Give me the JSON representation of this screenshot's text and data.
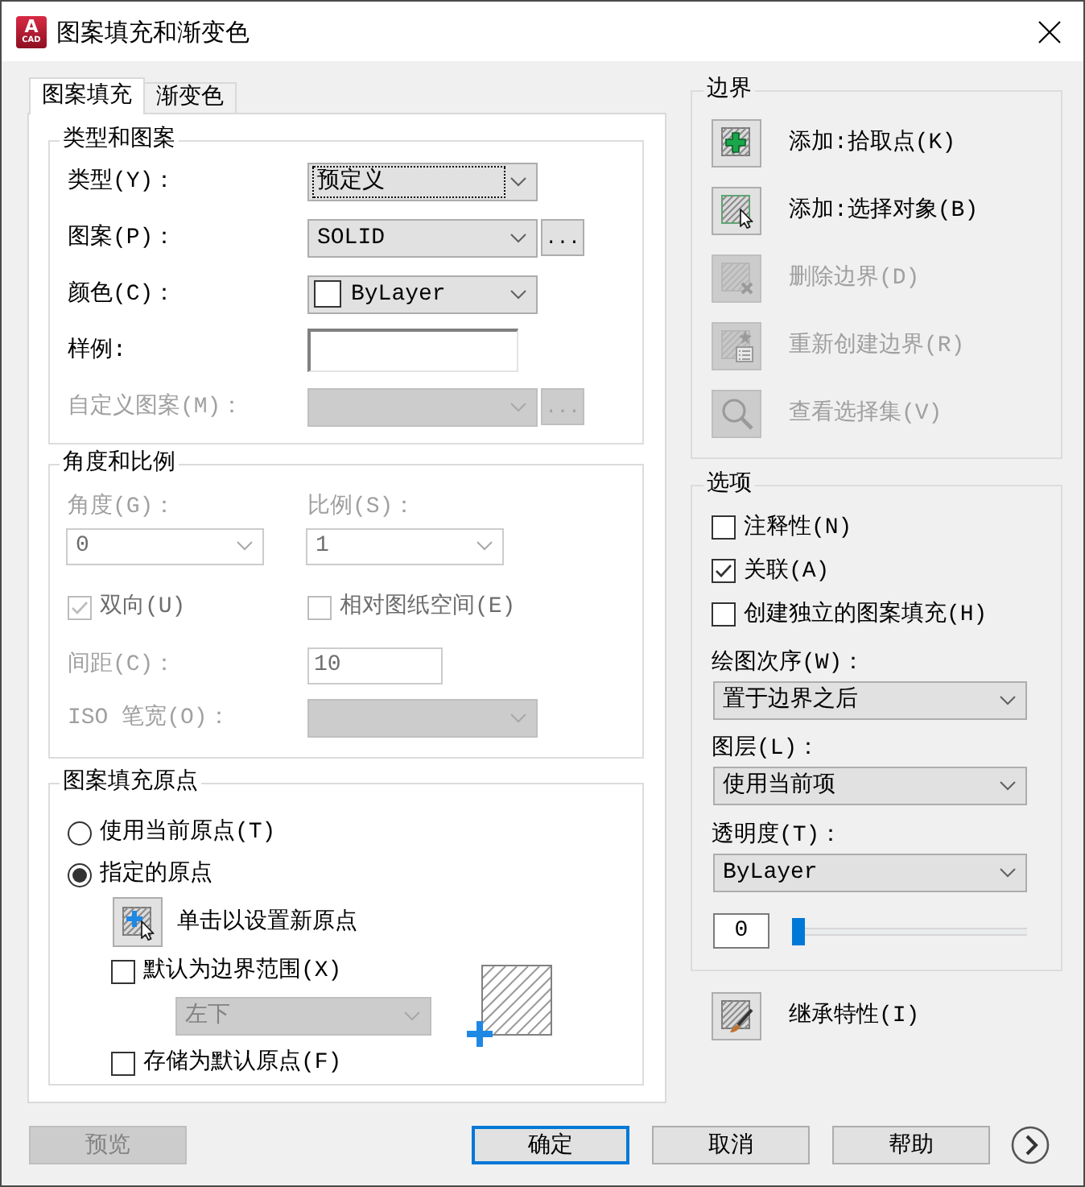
{
  "window": {
    "title": "图案填充和渐变色",
    "logo_letter": "A",
    "logo_caption": "CAD"
  },
  "tabs": [
    {
      "label": "图案填充",
      "selected": true
    },
    {
      "label": "渐变色",
      "selected": false
    }
  ],
  "type_and_pattern": {
    "title": "类型和图案",
    "type": {
      "label": "类型(Y)：",
      "value": "预定义",
      "focused": true
    },
    "pattern": {
      "label": "图案(P)：",
      "value": "SOLID",
      "browse": "..."
    },
    "color": {
      "label": "颜色(C)：",
      "value": "ByLayer"
    },
    "sample": {
      "label": "样例:"
    },
    "custom_pattern": {
      "label": "自定义图案(M)：",
      "browse": "...",
      "disabled": true
    }
  },
  "angle_and_scale": {
    "title": "角度和比例",
    "angle": {
      "label": "角度(G)：",
      "value": "0",
      "disabled": true
    },
    "scale": {
      "label": "比例(S)：",
      "value": "1",
      "disabled": true
    },
    "double": {
      "label": "双向(U)",
      "checked": true,
      "disabled": true
    },
    "relative_to_paper": {
      "label": "相对图纸空间(E)",
      "checked": false,
      "disabled": true
    },
    "spacing": {
      "label": "间距(C)：",
      "value": "10",
      "disabled": true
    },
    "iso_pen_width": {
      "label": "ISO 笔宽(O)：",
      "disabled": true
    }
  },
  "origin": {
    "title": "图案填充原点",
    "radios": [
      {
        "label": "使用当前原点(T)",
        "selected": false
      },
      {
        "label": "指定的原点",
        "selected": true
      }
    ],
    "set_origin": {
      "label": "单击以设置新原点"
    },
    "default_to_extents": {
      "label": "默认为边界范围(X)",
      "checked": false
    },
    "position": {
      "value": "左下",
      "disabled": true
    },
    "store_as_default": {
      "label": "存储为默认原点(F)",
      "checked": false
    }
  },
  "boundaries": {
    "title": "边界",
    "actions": [
      {
        "kind": "pick",
        "label": "添加:拾取点(K)",
        "disabled": false
      },
      {
        "kind": "select",
        "label": "添加:选择对象(B)",
        "disabled": false
      },
      {
        "kind": "remove",
        "label": "删除边界(D)",
        "disabled": true
      },
      {
        "kind": "recreate",
        "label": "重新创建边界(R)",
        "disabled": true
      },
      {
        "kind": "view",
        "label": "查看选择集(V)",
        "disabled": true
      }
    ]
  },
  "options": {
    "title": "选项",
    "checks": [
      {
        "label": "注释性(N)",
        "checked": false
      },
      {
        "label": "关联(A)",
        "checked": true
      },
      {
        "label": "创建独立的图案填充(H)",
        "checked": false
      }
    ],
    "draw_order": {
      "label": "绘图次序(W)：",
      "value": "置于边界之后"
    },
    "layer": {
      "label": "图层(L)：",
      "value": "使用当前项"
    },
    "transparency": {
      "label": "透明度(T)：",
      "value": "ByLayer"
    },
    "transparency_amount": {
      "value": "0",
      "level": 0
    }
  },
  "inherit": {
    "label": "继承特性(I)"
  },
  "buttons": [
    {
      "label": "预览",
      "disabled": true,
      "default": false
    },
    {
      "label": "确定",
      "disabled": false,
      "default": true
    },
    {
      "label": "取消",
      "disabled": false,
      "default": false
    },
    {
      "label": "帮助",
      "disabled": false,
      "default": false
    }
  ]
}
